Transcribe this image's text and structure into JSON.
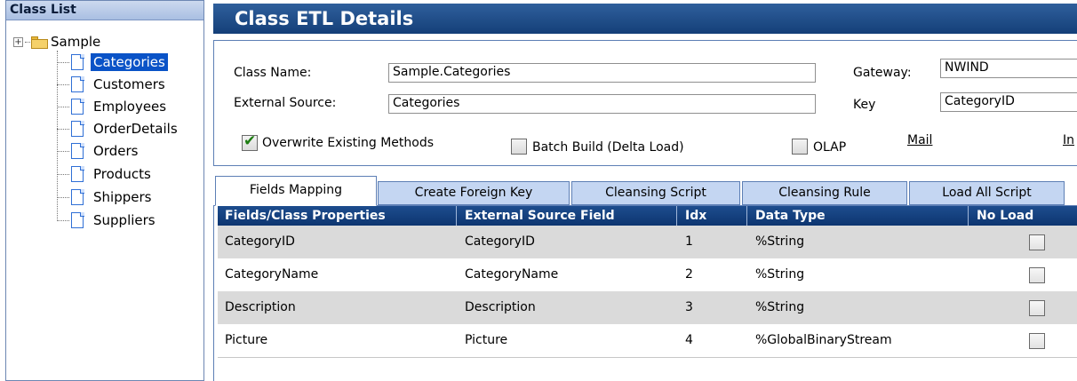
{
  "class_list": {
    "header": "Class List",
    "root": {
      "expander": "+",
      "label": "Sample"
    },
    "items": [
      {
        "label": "Categories",
        "selected": true
      },
      {
        "label": "Customers"
      },
      {
        "label": "Employees"
      },
      {
        "label": "OrderDetails"
      },
      {
        "label": "Orders"
      },
      {
        "label": "Products"
      },
      {
        "label": "Shippers"
      },
      {
        "label": "Suppliers"
      }
    ]
  },
  "details": {
    "title": "Class ETL Details",
    "class_name_label": "Class Name:",
    "class_name_value": "Sample.Categories",
    "external_source_label": "External Source:",
    "external_source_value": "Categories",
    "gateway_label": "Gateway:",
    "gateway_value": "NWIND",
    "key_label": "Key",
    "key_value": "CategoryID",
    "overwrite_label": "Overwrite Existing Methods",
    "overwrite_checked": true,
    "batch_build_label": "Batch Build (Delta Load)",
    "batch_build_checked": false,
    "olap_label": "OLAP",
    "olap_checked": false,
    "mail_link": "Mail",
    "in_link": "In"
  },
  "tabs": [
    {
      "label": "Fields Mapping",
      "active": true
    },
    {
      "label": "Create Foreign Key"
    },
    {
      "label": "Cleansing Script"
    },
    {
      "label": "Cleansing Rule"
    },
    {
      "label": "Load All Script"
    }
  ],
  "grid": {
    "columns": [
      "Fields/Class Properties",
      "External Source Field",
      "Idx",
      "Data Type",
      "No Load"
    ],
    "rows": [
      {
        "property": "CategoryID",
        "source": "CategoryID",
        "idx": "1",
        "type": "%String",
        "no_load": false
      },
      {
        "property": "CategoryName",
        "source": "CategoryName",
        "idx": "2",
        "type": "%String",
        "no_load": false
      },
      {
        "property": "Description",
        "source": "Description",
        "idx": "3",
        "type": "%String",
        "no_load": false
      },
      {
        "property": "Picture",
        "source": "Picture",
        "idx": "4",
        "type": "%GlobalBinaryStream",
        "no_load": false
      }
    ]
  },
  "colors": {
    "title_bar": "#143f78",
    "selected_item": "#0a53c7",
    "tab_inactive": "#c4d6f2",
    "row_shaded": "#dadada"
  }
}
